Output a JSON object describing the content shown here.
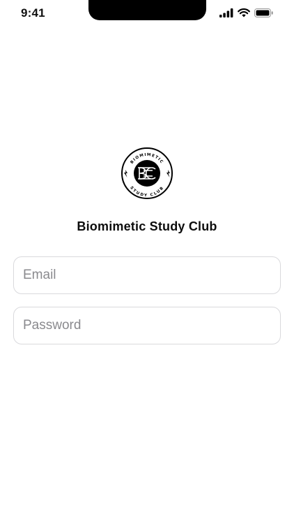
{
  "status_bar": {
    "time": "9:41"
  },
  "brand": {
    "title": "Biomimetic Study Club",
    "logo": {
      "top_text": "BIOMIMETIC",
      "bottom_text": "STUDY CLUB",
      "monogram": "BSC"
    }
  },
  "form": {
    "email": {
      "placeholder": "Email",
      "value": ""
    },
    "password": {
      "placeholder": "Password",
      "value": ""
    }
  }
}
